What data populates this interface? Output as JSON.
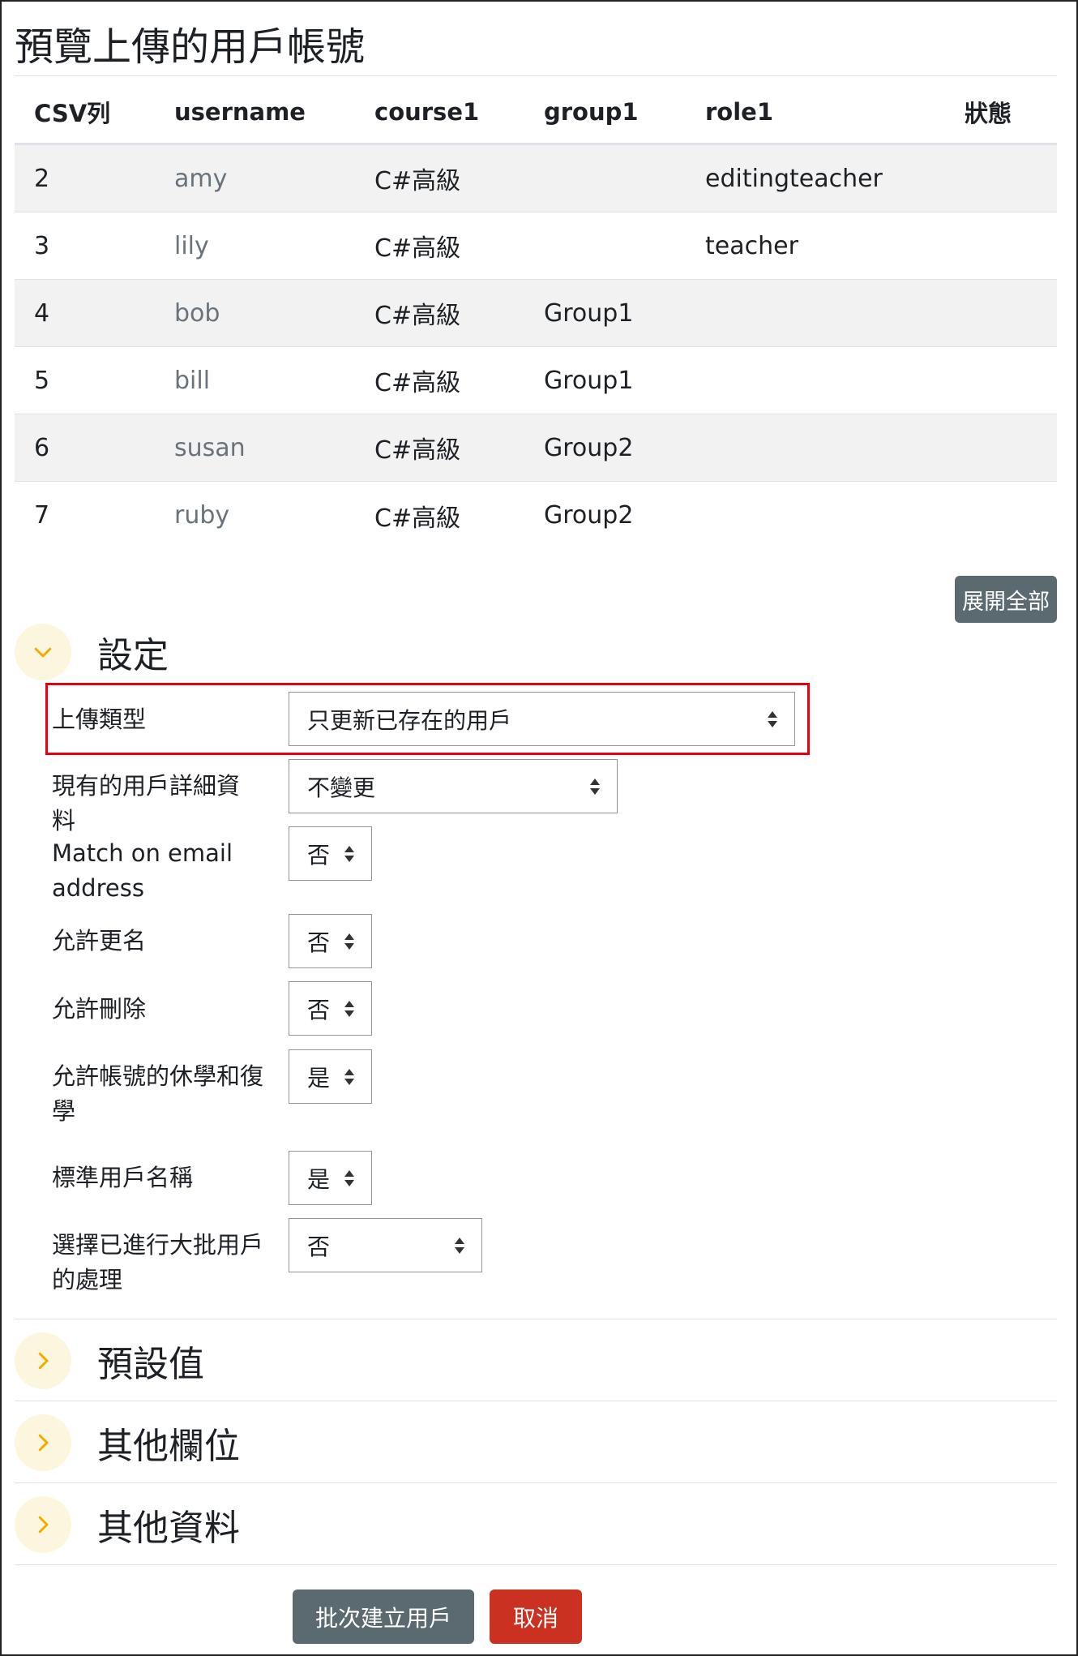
{
  "page": {
    "title": "預覽上傳的用戶帳號"
  },
  "table": {
    "headers": [
      "CSV列",
      "username",
      "course1",
      "group1",
      "role1",
      "狀態"
    ],
    "rows": [
      [
        "2",
        "amy",
        "C#高級",
        "",
        "editingteacher",
        ""
      ],
      [
        "3",
        "lily",
        "C#高級",
        "",
        "teacher",
        ""
      ],
      [
        "4",
        "bob",
        "C#高級",
        "Group1",
        "",
        ""
      ],
      [
        "5",
        "bill",
        "C#高級",
        "Group1",
        "",
        ""
      ],
      [
        "6",
        "susan",
        "C#高級",
        "Group2",
        "",
        ""
      ],
      [
        "7",
        "ruby",
        "C#高級",
        "Group2",
        "",
        ""
      ]
    ]
  },
  "expand_all_label": "展開全部",
  "sections": {
    "settings": "設定",
    "defaults": "預設值",
    "other_fields": "其他欄位",
    "other_data": "其他資料"
  },
  "settings_fields": {
    "upload_type": {
      "label": "上傳類型",
      "value": "只更新已存在的用戶"
    },
    "existing_details": {
      "label": "現有的用戶詳細資料",
      "value": "不變更"
    },
    "match_email": {
      "label": "Match on email address",
      "value": "否"
    },
    "allow_rename": {
      "label": "允許更名",
      "value": "否"
    },
    "allow_delete": {
      "label": "允許刪除",
      "value": "否"
    },
    "allow_suspend": {
      "label": "允許帳號的休學和復學",
      "value": "是"
    },
    "std_username": {
      "label": "標準用戶名稱",
      "value": "是"
    },
    "bulk_action": {
      "label": "選擇已進行大批用戶的處理",
      "value": "否"
    }
  },
  "buttons": {
    "submit": "批次建立用戶",
    "cancel": "取消"
  },
  "colors": {
    "highlight": "#e60012",
    "primary_button": "#5b6a70",
    "cancel_button": "#ca3120",
    "chevron": "#f0ad00"
  }
}
